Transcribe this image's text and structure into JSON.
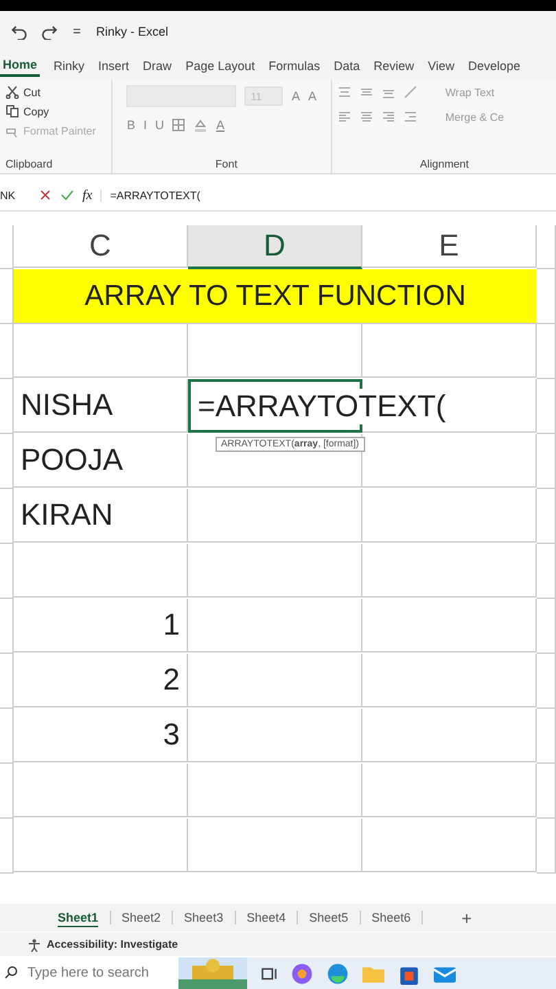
{
  "window": {
    "title": "Rinky - Excel"
  },
  "ribbon_tabs": [
    {
      "label": "Home",
      "selected": true
    },
    {
      "label": "Rinky",
      "selected": false
    },
    {
      "label": "Insert",
      "selected": false
    },
    {
      "label": "Draw",
      "selected": false
    },
    {
      "label": "Page Layout",
      "selected": false
    },
    {
      "label": "Formulas",
      "selected": false
    },
    {
      "label": "Data",
      "selected": false
    },
    {
      "label": "Review",
      "selected": false
    },
    {
      "label": "View",
      "selected": false
    },
    {
      "label": "Develope",
      "selected": false
    }
  ],
  "clipboard": {
    "label": "Clipboard",
    "items": [
      {
        "kind": "cut",
        "label": "Cut",
        "disabled": false
      },
      {
        "kind": "copy",
        "label": "Copy",
        "disabled": false
      },
      {
        "kind": "painter",
        "label": "Format Painter",
        "disabled": true
      }
    ]
  },
  "font": {
    "label": "Font",
    "size": "11",
    "grow": [
      "A",
      "A"
    ],
    "styles": [
      "B",
      "I",
      "U"
    ],
    "color_letter": "A"
  },
  "alignment": {
    "label": "Alignment",
    "wrap": "Wrap Text",
    "merge": "Merge & Ce"
  },
  "formula_bar": {
    "name_box": "NK",
    "fx": "fx",
    "formula": "=ARRAYTOTEXT("
  },
  "columns": [
    {
      "label": "C",
      "selected": false
    },
    {
      "label": "D",
      "selected": true
    },
    {
      "label": "E",
      "selected": false
    }
  ],
  "rows": [
    {
      "kind": "banner",
      "text": "ARRAY TO TEXT FUNCTION"
    },
    {
      "kind": "blank"
    },
    {
      "kind": "text",
      "c": "NISHA",
      "d": "=ARRAYTOTEXT(",
      "tooltip": "ARRAYTOTEXT(**array**, [format])"
    },
    {
      "kind": "text",
      "c": "POOJA"
    },
    {
      "kind": "text",
      "c": "KIRAN"
    },
    {
      "kind": "blank"
    },
    {
      "kind": "number",
      "c": "1"
    },
    {
      "kind": "number",
      "c": "2"
    },
    {
      "kind": "number",
      "c": "3"
    },
    {
      "kind": "blank"
    },
    {
      "kind": "blank"
    }
  ],
  "sheets": [
    {
      "label": "Sheet1",
      "selected": true
    },
    {
      "label": "Sheet2",
      "selected": false
    },
    {
      "label": "Sheet3",
      "selected": false
    },
    {
      "label": "Sheet4",
      "selected": false
    },
    {
      "label": "Sheet5",
      "selected": false
    },
    {
      "label": "Sheet6",
      "selected": false
    }
  ],
  "add_sheet": "+",
  "status_bar": {
    "accessibility": "Accessibility: Investigate"
  },
  "taskbar": {
    "search_placeholder": "Type here to search"
  }
}
